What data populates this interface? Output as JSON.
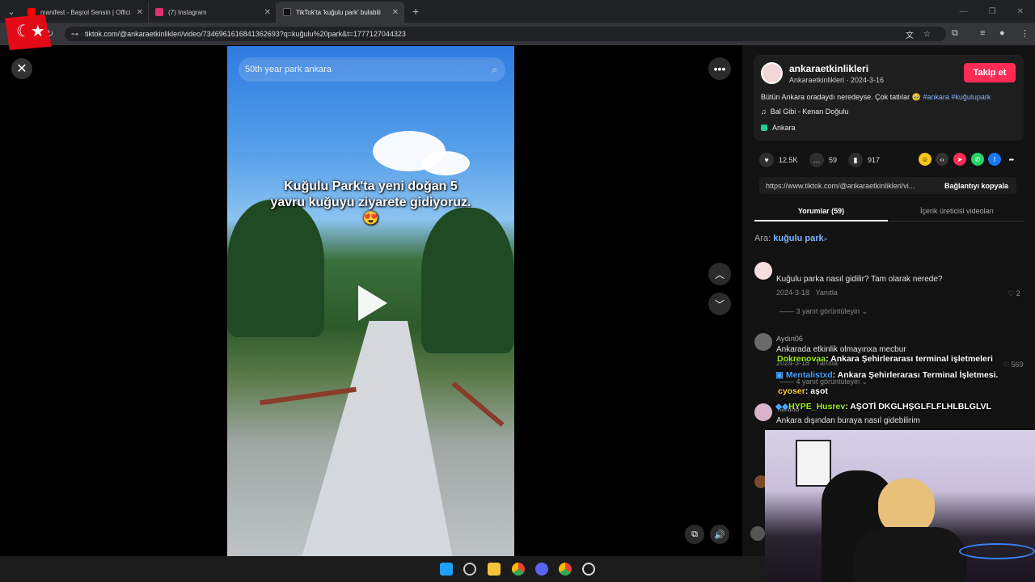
{
  "browser": {
    "tabs": [
      {
        "title": "manifest - Başrol Sensin | Offici",
        "color": "#ff0000"
      },
      {
        "title": "(7) Instagram",
        "color": "#e1306c"
      },
      {
        "title": "TikTok'ta 'kuğulu park' bulabili",
        "color": "#111111"
      }
    ],
    "url": "tiktok.com/@ankaraetkinlikleri/video/7346961616841362693?q=kuğulu%20park&t=1777127044323"
  },
  "video": {
    "search_placeholder": "50th year park ankara",
    "caption": "Kuğulu Park'ta yeni doğan 5 yavru kuğuyu ziyarete gidiyoruz. 😍"
  },
  "post": {
    "username": "ankaraetkinlikleri",
    "display_name": "Ankaraetkinlikleri",
    "date": "2024-3-16",
    "follow_label": "Takip et",
    "description": "Bütün Ankara oradaydı neredeyse. Çok tatlılar 🥹",
    "hashtags": "#ankara #kuğulupark",
    "music": "Bal Gibi - Kenan Doğulu",
    "location": "Ankara",
    "likes": "12.5K",
    "comments": "59",
    "saves": "917",
    "link": "https://www.tiktok.com/@ankaraetkinlikleri/vi...",
    "copy_label": "Bağlantıyı kopyala"
  },
  "comment_tabs": {
    "comments": "Yorumlar (59)",
    "creator_videos": "İçerik üreticisi videoları"
  },
  "search": {
    "prefix": "Ara:",
    "query": "kuğulu park"
  },
  "comments": [
    {
      "text": "Kuğulu parka nasıl gidilir? Tam olarak nerede?",
      "date": "2024-3-18",
      "reply": "Yanıtla",
      "likes": "2",
      "replies": "3 yanıt görüntüleyin"
    },
    {
      "user": "Aydın06",
      "text": "Ankarada etkinlik olmayınxa mecbur",
      "date": "2024-3-18",
      "reply": "Yanıtla",
      "likes": "569",
      "replies": "4 yanıt görüntüleyin"
    },
    {
      "user": "Tatlıino",
      "text": "Ankara dışından buraya nasıl gidebilirim"
    }
  ],
  "stream_chat": [
    {
      "user": "Dokrenovaa",
      "msg": ": Ankara Şehirlerarası terminal işletmeleri",
      "color": "#9ef01a"
    },
    {
      "user": "Mentalistxd",
      "msg": ": Ankara Şehirlerarası Terminal İşletmesi.",
      "color": "#4aa3ff"
    },
    {
      "user": "cyoser",
      "msg": ": aşot",
      "color": "#ffd43b"
    },
    {
      "user": "HYPE_Husrev",
      "msg": ": AŞOTİ DKGLHŞGLFLFLHLBLGLVL",
      "color": "#9ef01a"
    }
  ],
  "colors": {
    "accent": "#fe2c55",
    "link": "#7db6ff"
  }
}
